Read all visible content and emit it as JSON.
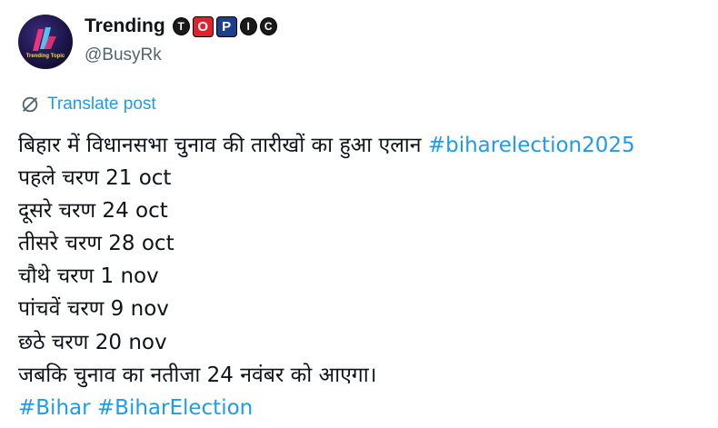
{
  "author": {
    "display_name": "Trending",
    "badge_letters": [
      "T",
      "O",
      "P",
      "I",
      "C"
    ],
    "handle": "@BusyRk",
    "avatar_caption": "Trending Topic"
  },
  "translate": {
    "label": "Translate post",
    "icon": "translate-icon"
  },
  "post": {
    "lines": [
      "बिहार में विधानसभा चुनाव की तारीखों का हुआ एलान",
      "पहले चरण 21 oct",
      "दूसरे चरण 24 oct",
      "तीसरे चरण 28 oct",
      "चौथे चरण 1 nov",
      "पांचवें चरण 9 nov",
      "छठे चरण 20 nov",
      "जबकि चुनाव का नतीजा 24 नवंबर को आएगा।"
    ],
    "hashtag_inline": "#biharelection2025",
    "hashtags": [
      "#Bihar",
      "#BiharElection"
    ]
  },
  "colors": {
    "link": "#1d9bf0",
    "text": "#0f1419",
    "muted": "#536471",
    "badge_red": "#e4212b",
    "badge_blue": "#1b3f8f"
  }
}
